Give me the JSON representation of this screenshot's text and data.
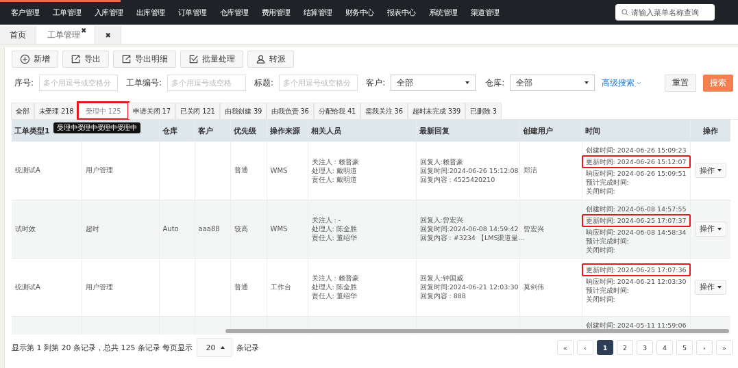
{
  "top_nav": {
    "items": [
      {
        "label": "客户管理"
      },
      {
        "label": "工单管理"
      },
      {
        "label": "入库管理"
      },
      {
        "label": "出库管理"
      },
      {
        "label": "订单管理"
      },
      {
        "label": "仓库管理"
      },
      {
        "label": "费用管理"
      },
      {
        "label": "结算管理"
      },
      {
        "label": "财务中心"
      },
      {
        "label": "报表中心"
      },
      {
        "label": "系统管理"
      },
      {
        "label": "渠道管理"
      }
    ],
    "search": {
      "placeholder": "请输入菜单名称查询"
    }
  },
  "page_tabs": [
    {
      "label": "首页",
      "selected": false
    },
    {
      "label": "工单管理",
      "selected": true,
      "close": "✖"
    },
    {
      "selected": false,
      "close": "✖"
    }
  ],
  "toolbar": [
    {
      "label": "新增",
      "kind": "add"
    },
    {
      "label": "导出",
      "kind": "export"
    },
    {
      "label": "导出明细",
      "kind": "export"
    },
    {
      "label": "批量处理",
      "kind": "batch"
    },
    {
      "label": "转派",
      "kind": "assign"
    }
  ],
  "filters": [
    {
      "kind": "input",
      "label": "序号:",
      "placeholder": "多个用逗号或空格分"
    },
    {
      "kind": "input",
      "label": "工单编号:",
      "placeholder": "多个用逗号或空格"
    },
    {
      "kind": "input",
      "label": "标题:",
      "placeholder": "多个用逗号或空格分"
    },
    {
      "kind": "select",
      "label": "客户:",
      "value": "全部"
    },
    {
      "kind": "select",
      "label": "仓库:",
      "value": "全部"
    }
  ],
  "advanced_search": "高级搜索",
  "reset_button": "重置",
  "search_button": "搜索",
  "status_tabs": [
    {
      "label": "全部",
      "selected": false,
      "annotated": false
    },
    {
      "label": "未受理 218",
      "selected": false,
      "annotated": false
    },
    {
      "label": "受理中 125",
      "selected": true,
      "annotated": true
    },
    {
      "label": "申请关闭 17",
      "selected": false,
      "annotated": false
    },
    {
      "label": "已关闭 121",
      "selected": false,
      "annotated": false
    },
    {
      "label": "由我创建 39",
      "selected": false,
      "annotated": false
    },
    {
      "label": "由我负责 36",
      "selected": false,
      "annotated": false
    },
    {
      "label": "分配给我 41",
      "selected": false,
      "annotated": false
    },
    {
      "label": "需我关注 36",
      "selected": false,
      "annotated": false
    },
    {
      "label": "超时未完成 339",
      "selected": false,
      "annotated": false
    },
    {
      "label": "已删除 3",
      "selected": false,
      "annotated": false
    }
  ],
  "tooltip": "受理中受理中受理中受理中",
  "table": {
    "columns": [
      {
        "label": "工单类型1"
      },
      {},
      {
        "label": "仓库"
      },
      {
        "label": "客户"
      },
      {
        "label": "优先级"
      },
      {
        "label": "操作来源"
      },
      {
        "label": "相关人员"
      },
      {
        "label": "最新回复"
      },
      {
        "label": "创建用户"
      },
      {
        "label": "时间"
      },
      {
        "label": "操作"
      }
    ],
    "rows": [
      {
        "type1": "统测试A",
        "type2": "用户管理",
        "warehouse": "",
        "customer": "",
        "priority": "普通",
        "source": "WMS",
        "people": [
          "关注人 : 赖普豪",
          "处理人:  戴明道",
          "责任人:  戴明道"
        ],
        "reply": [
          "回复人:赖普豪",
          "回复时间:2024-06-26 15:12:08",
          "回复内容 : 4525420210"
        ],
        "creator": "郑洁",
        "times": [
          {
            "text": "创建时间:  2024-06-26 15:09:23",
            "annotated": false
          },
          {
            "text": "更新时间:  2024-06-26 15:12:07",
            "annotated": true
          },
          {
            "text": "响应时间:  2024-06-26 15:09:51",
            "annotated": false
          },
          {
            "text": "预计完成时间:",
            "annotated": false
          },
          {
            "text": "关闭时间:",
            "annotated": false
          }
        ],
        "action": "操作"
      },
      {
        "type1": "试时效",
        "type2": "超时",
        "warehouse": "Auto",
        "customer": "aaa88",
        "priority": "较高",
        "source": "WMS",
        "people": [
          "关注人 : -",
          "处理人:  陈全胜",
          "责任人:  董绍华"
        ],
        "reply": [
          "回复人:曾宏兴",
          "回复时间:2024-06-08 14:59:42",
          "回复内容 : #3234 【LMS渠道量..."
        ],
        "creator": "曾宏兴",
        "times": [
          {
            "text": "创建时间:  2024-06-08 14:57:55",
            "annotated": false
          },
          {
            "text": "更新时间:  2024-06-25 17:07:37",
            "annotated": true
          },
          {
            "text": "响应时间:  2024-06-08 14:58:34",
            "annotated": false
          },
          {
            "text": "预计完成时间:",
            "annotated": false
          },
          {
            "text": "关闭时间:",
            "annotated": false
          }
        ],
        "action": "操作"
      },
      {
        "type1": "统测试A",
        "type2": "用户管理",
        "warehouse": "",
        "customer": "",
        "priority": "普通",
        "source": "工作台",
        "people": [
          "关注人 : 赖普豪",
          "处理人:  陈全胜",
          "责任人:  董绍华"
        ],
        "reply": [
          "回复人:钟国威",
          "回复时间:2024-06-21 12:03:30",
          "回复内容 : 888"
        ],
        "creator": "莫剑伟",
        "times": [
          {
            "text": "更新时间:  2024-06-25 17:07:36",
            "annotated": true
          },
          {
            "text": "响应时间:  2024-06-21 12:03:30",
            "annotated": false
          },
          {
            "text": "预计完成时间:",
            "annotated": false
          },
          {
            "text": "关闭时间:",
            "annotated": false
          }
        ],
        "action": "操作"
      },
      {
        "type1": "",
        "type2": "",
        "warehouse": "",
        "customer": "",
        "priority": "",
        "source": "",
        "people": [],
        "reply": [],
        "creator": "",
        "times": [
          {
            "text": "创建时间:  2024-05-11 11:59:06",
            "annotated": false
          }
        ],
        "action": ""
      }
    ]
  },
  "footer": {
    "summary": "显示第 1 到第 20 条记录，总共 125 条记录 每页显示",
    "page_size": "20",
    "suffix": "条记录"
  },
  "pagination": [
    {
      "label": "«",
      "selected": false
    },
    {
      "label": "‹",
      "selected": false
    },
    {
      "label": "1",
      "selected": true
    },
    {
      "label": "2",
      "selected": false
    },
    {
      "label": "3",
      "selected": false
    },
    {
      "label": "4",
      "selected": false
    },
    {
      "label": "5",
      "selected": false
    },
    {
      "label": "›",
      "selected": false
    },
    {
      "label": "»",
      "selected": false
    }
  ]
}
